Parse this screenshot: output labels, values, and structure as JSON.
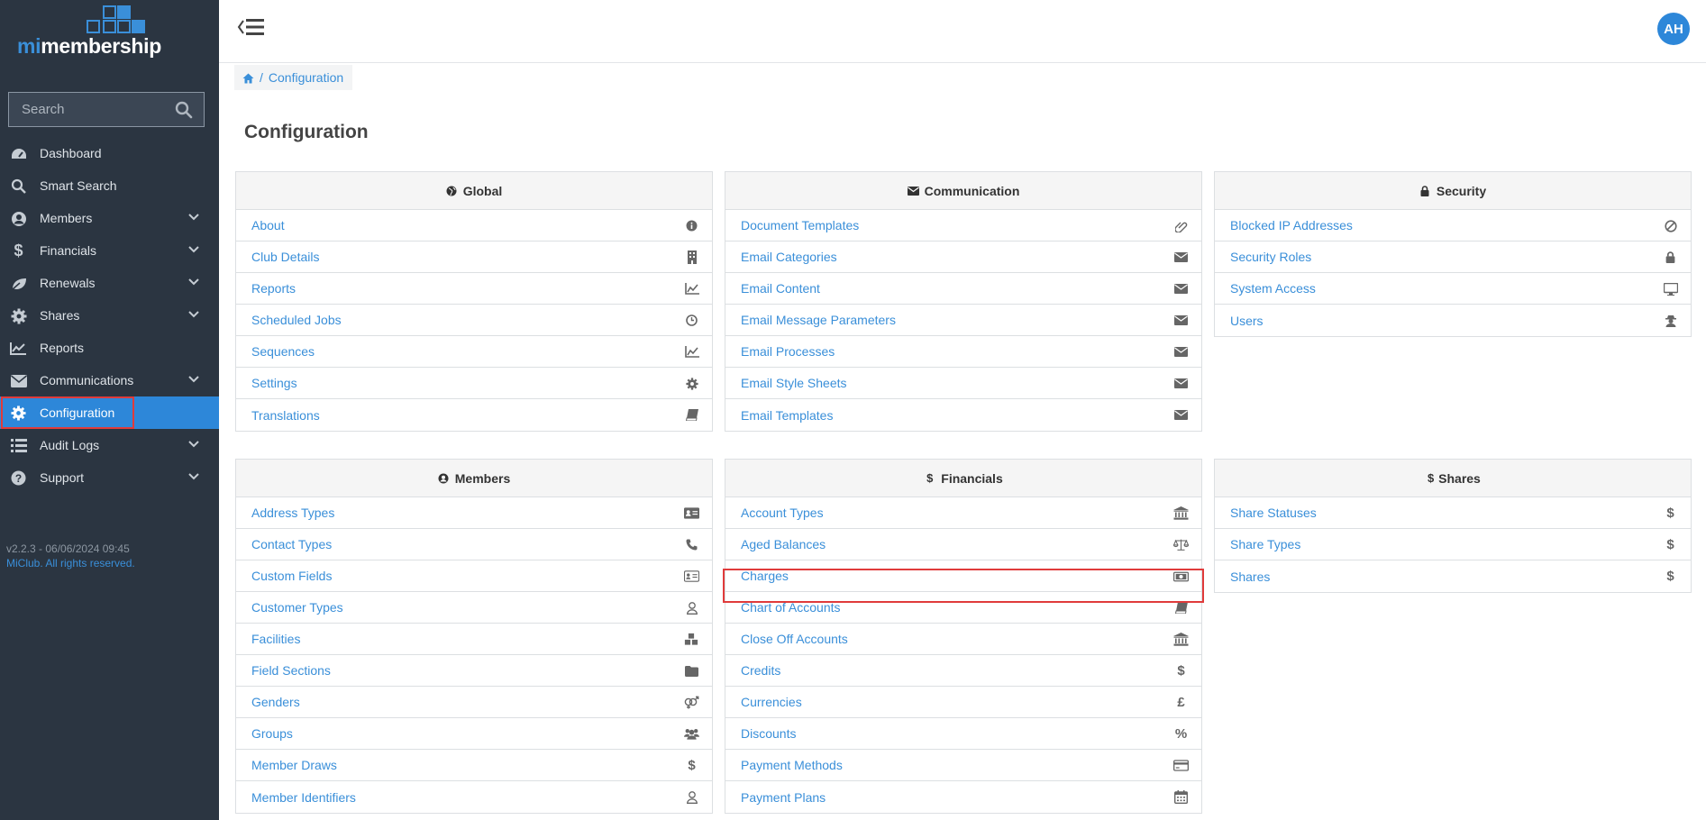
{
  "app": {
    "logo_prefix": "mi",
    "logo_suffix": "membership"
  },
  "search": {
    "placeholder": "Search"
  },
  "nav": {
    "items": [
      {
        "label": "Dashboard",
        "icon": "dashboard-icon",
        "expandable": false
      },
      {
        "label": "Smart Search",
        "icon": "search-icon",
        "expandable": false
      },
      {
        "label": "Members",
        "icon": "user-circle-icon",
        "expandable": true
      },
      {
        "label": "Financials",
        "icon": "dollar-icon",
        "expandable": true
      },
      {
        "label": "Renewals",
        "icon": "leaf-icon",
        "expandable": true
      },
      {
        "label": "Shares",
        "icon": "cog-icon",
        "expandable": true
      },
      {
        "label": "Reports",
        "icon": "line-chart-icon",
        "expandable": false
      },
      {
        "label": "Communications",
        "icon": "envelope-icon",
        "expandable": true
      },
      {
        "label": "Configuration",
        "icon": "gear-icon",
        "expandable": false,
        "active": true
      },
      {
        "label": "Audit Logs",
        "icon": "list-icon",
        "expandable": true
      },
      {
        "label": "Support",
        "icon": "question-icon",
        "expandable": true
      }
    ]
  },
  "version": {
    "text": "v2.2.3 - 06/06/2024 09:45",
    "copyright": "MiClub. All rights reserved."
  },
  "user": {
    "initials": "AH"
  },
  "breadcrumb": {
    "separator": "/",
    "current": "Configuration"
  },
  "page": {
    "title": "Configuration"
  },
  "panels": {
    "global": {
      "title": "Global",
      "items": [
        {
          "label": "About",
          "icon": "info-icon"
        },
        {
          "label": "Club Details",
          "icon": "building-icon"
        },
        {
          "label": "Reports",
          "icon": "line-chart-icon"
        },
        {
          "label": "Scheduled Jobs",
          "icon": "clock-icon"
        },
        {
          "label": "Sequences",
          "icon": "line-chart-icon"
        },
        {
          "label": "Settings",
          "icon": "gear-icon"
        },
        {
          "label": "Translations",
          "icon": "book-icon"
        }
      ]
    },
    "communication": {
      "title": "Communication",
      "items": [
        {
          "label": "Document Templates",
          "icon": "paperclip-icon"
        },
        {
          "label": "Email Categories",
          "icon": "envelope-icon"
        },
        {
          "label": "Email Content",
          "icon": "envelope-icon"
        },
        {
          "label": "Email Message Parameters",
          "icon": "envelope-icon"
        },
        {
          "label": "Email Processes",
          "icon": "envelope-icon"
        },
        {
          "label": "Email Style Sheets",
          "icon": "envelope-icon"
        },
        {
          "label": "Email Templates",
          "icon": "envelope-icon"
        }
      ]
    },
    "security": {
      "title": "Security",
      "items": [
        {
          "label": "Blocked IP Addresses",
          "icon": "ban-icon"
        },
        {
          "label": "Security Roles",
          "icon": "lock-icon"
        },
        {
          "label": "System Access",
          "icon": "desktop-icon"
        },
        {
          "label": "Users",
          "icon": "user-secret-icon"
        }
      ]
    },
    "members": {
      "title": "Members",
      "items": [
        {
          "label": "Address Types",
          "icon": "address-card-icon"
        },
        {
          "label": "Contact Types",
          "icon": "phone-icon"
        },
        {
          "label": "Custom Fields",
          "icon": "id-card-icon"
        },
        {
          "label": "Customer Types",
          "icon": "user-outline-icon"
        },
        {
          "label": "Facilities",
          "icon": "cubes-icon"
        },
        {
          "label": "Field Sections",
          "icon": "folder-icon"
        },
        {
          "label": "Genders",
          "icon": "gender-icon"
        },
        {
          "label": "Groups",
          "icon": "users-icon"
        },
        {
          "label": "Member Draws",
          "icon": "dollar-icon"
        },
        {
          "label": "Member Identifiers",
          "icon": "user-outline-icon"
        }
      ]
    },
    "financials": {
      "title": "Financials",
      "items": [
        {
          "label": "Account Types",
          "icon": "bank-icon"
        },
        {
          "label": "Aged Balances",
          "icon": "balance-scale-icon"
        },
        {
          "label": "Charges",
          "icon": "money-bill-icon"
        },
        {
          "label": "Chart of Accounts",
          "icon": "book-icon"
        },
        {
          "label": "Close Off Accounts",
          "icon": "bank-icon"
        },
        {
          "label": "Credits",
          "icon": "dollar-icon"
        },
        {
          "label": "Currencies",
          "icon": "pound-icon"
        },
        {
          "label": "Discounts",
          "icon": "percent-icon"
        },
        {
          "label": "Payment Methods",
          "icon": "credit-card-icon"
        },
        {
          "label": "Payment Plans",
          "icon": "calendar-icon"
        }
      ]
    },
    "shares": {
      "title": "Shares",
      "items": [
        {
          "label": "Share Statuses",
          "icon": "dollar-icon"
        },
        {
          "label": "Share Types",
          "icon": "dollar-icon"
        },
        {
          "label": "Shares",
          "icon": "dollar-icon"
        }
      ]
    }
  },
  "glyphs": {
    "dollar": "$",
    "pound": "£",
    "percent": "%"
  },
  "colors": {
    "accent": "#2d87d9",
    "link": "#3a8fd9",
    "sidebar": "#2b3541",
    "highlight": "#e03b3b"
  }
}
